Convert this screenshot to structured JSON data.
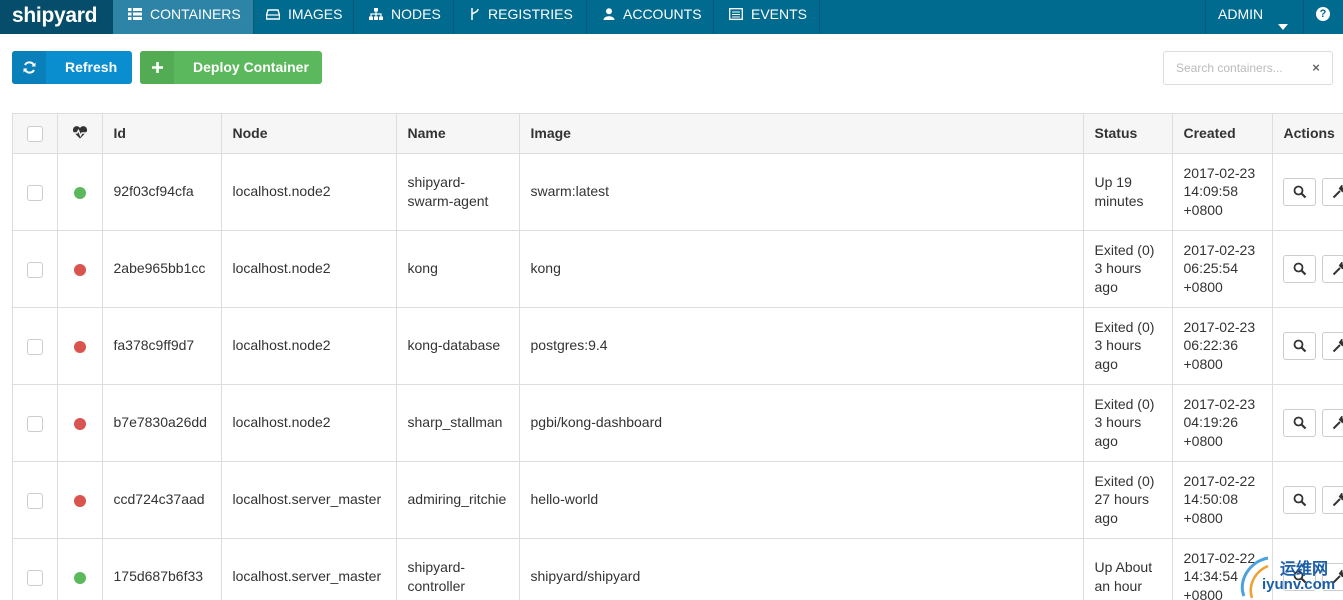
{
  "app": {
    "brand": "shipyard"
  },
  "nav": {
    "items": [
      {
        "key": "containers",
        "label": "CONTAINERS",
        "icon": "grid-icon",
        "active": true
      },
      {
        "key": "images",
        "label": "IMAGES",
        "icon": "hdd-icon"
      },
      {
        "key": "nodes",
        "label": "NODES",
        "icon": "sitemap-icon"
      },
      {
        "key": "registries",
        "label": "REGISTRIES",
        "icon": "branch-icon"
      },
      {
        "key": "accounts",
        "label": "ACCOUNTS",
        "icon": "user-icon"
      },
      {
        "key": "events",
        "label": "EVENTS",
        "icon": "list-icon"
      }
    ],
    "user_label": "ADMIN",
    "help_label": "?"
  },
  "toolbar": {
    "refresh_label": "Refresh",
    "deploy_label": "Deploy Container",
    "search_placeholder": "Search containers...",
    "clear_label": "×"
  },
  "table": {
    "columns": {
      "health": "heartbeat-icon",
      "id": "Id",
      "node": "Node",
      "name": "Name",
      "image": "Image",
      "status": "Status",
      "created": "Created",
      "actions": "Actions"
    },
    "rows": [
      {
        "state": "running",
        "id": "92f03cf94cfa",
        "node": "localhost.node2",
        "name": "shipyard-swarm-agent",
        "image": "swarm:latest",
        "status": "Up 19 minutes",
        "created": "2017-02-23 14:09:58 +0800"
      },
      {
        "state": "exited",
        "id": "2abe965bb1cc",
        "node": "localhost.node2",
        "name": "kong",
        "image": "kong",
        "status": "Exited (0) 3 hours ago",
        "created": "2017-02-23 06:25:54 +0800"
      },
      {
        "state": "exited",
        "id": "fa378c9ff9d7",
        "node": "localhost.node2",
        "name": "kong-database",
        "image": "postgres:9.4",
        "status": "Exited (0) 3 hours ago",
        "created": "2017-02-23 06:22:36 +0800"
      },
      {
        "state": "exited",
        "id": "b7e7830a26dd",
        "node": "localhost.node2",
        "name": "sharp_stallman",
        "image": "pgbi/kong-dashboard",
        "status": "Exited (0) 3 hours ago",
        "created": "2017-02-23 04:19:26 +0800"
      },
      {
        "state": "exited",
        "id": "ccd724c37aad",
        "node": "localhost.server_master",
        "name": "admiring_ritchie",
        "image": "hello-world",
        "status": "Exited (0) 27 hours ago",
        "created": "2017-02-22 14:50:08 +0800"
      },
      {
        "state": "running",
        "id": "175d687b6f33",
        "node": "localhost.server_master",
        "name": "shipyard-controller",
        "image": "shipyard/shipyard",
        "status": "Up About an hour",
        "created": "2017-02-22 14:34:54 +0800"
      }
    ]
  },
  "colors": {
    "running": "#5cb85c",
    "exited": "#d9534f",
    "navbar": "#006a8f",
    "brand_bg": "#054d6a",
    "active_tab": "#2e84a6"
  },
  "watermark": {
    "line1": "运维网",
    "line2": "iyunv.com"
  }
}
